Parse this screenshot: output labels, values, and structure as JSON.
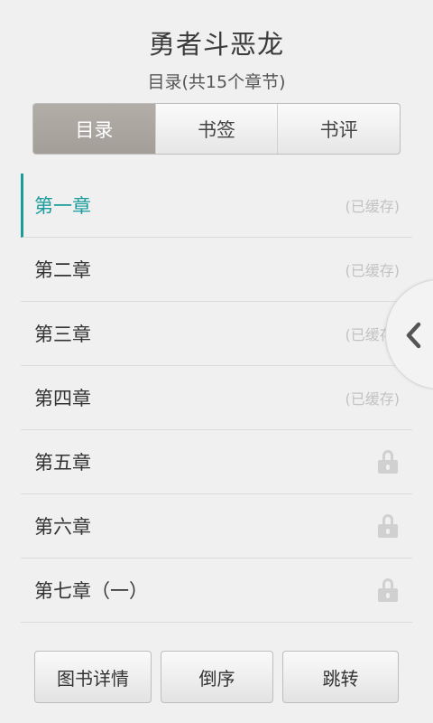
{
  "header": {
    "book_title": "勇者斗恶龙",
    "toc_subtitle": "目录(共15个章节)"
  },
  "tabs": [
    {
      "label": "目录",
      "active": true
    },
    {
      "label": "书签",
      "active": false
    },
    {
      "label": "书评",
      "active": false
    }
  ],
  "chapters": [
    {
      "title": "第一章",
      "status": "(已缓存)",
      "locked": false,
      "current": true
    },
    {
      "title": "第二章",
      "status": "(已缓存)",
      "locked": false,
      "current": false
    },
    {
      "title": "第三章",
      "status": "(已缓存)",
      "locked": false,
      "current": false
    },
    {
      "title": "第四章",
      "status": "(已缓存)",
      "locked": false,
      "current": false
    },
    {
      "title": "第五章",
      "status": "",
      "locked": true,
      "current": false
    },
    {
      "title": "第六章",
      "status": "",
      "locked": true,
      "current": false
    },
    {
      "title": "第七章（一）",
      "status": "",
      "locked": true,
      "current": false
    }
  ],
  "icons": {
    "lock": "lock-icon",
    "side_handle": "chevron-left-icon"
  },
  "bottom_buttons": {
    "detail_label": "图书详情",
    "reverse_label": "倒序",
    "jump_label": "跳转"
  },
  "colors": {
    "accent": "#1a9c9c",
    "active_tab": "#aba59f",
    "background": "#f0f0f0"
  }
}
